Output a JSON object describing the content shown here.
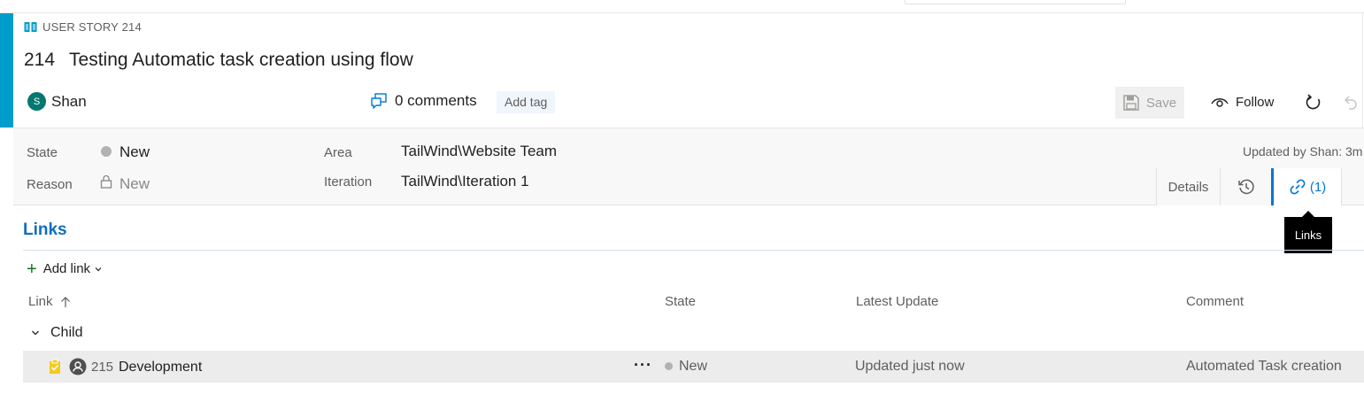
{
  "header": {
    "type_label": "USER STORY 214",
    "id": "214",
    "title": "Testing Automatic task creation using flow",
    "assignee_initial": "S",
    "assignee": "Shan",
    "comments": "0 comments",
    "add_tag": "Add tag",
    "save_label": "Save",
    "follow_label": "Follow"
  },
  "fields": {
    "state_label": "State",
    "state_value": "New",
    "reason_label": "Reason",
    "reason_value": "New",
    "area_label": "Area",
    "area_value": "TailWind\\Website Team",
    "iteration_label": "Iteration",
    "iteration_value": "TailWind\\Iteration 1",
    "updated_text": "Updated by Shan: 3m"
  },
  "tabs": {
    "details": "Details",
    "links": "(1)",
    "tooltip": "Links"
  },
  "links": {
    "section_title": "Links",
    "add_link": "Add link",
    "columns": {
      "link": "Link",
      "state": "State",
      "latest_update": "Latest Update",
      "comment": "Comment"
    },
    "group_label": "Child",
    "rows": [
      {
        "id": "215",
        "title": "Development",
        "state": "New",
        "latest_update": "Updated just now",
        "comment": "Automated Task creation"
      }
    ]
  },
  "colors": {
    "accent": "#009ccc",
    "link_blue": "#0078d4",
    "avatar": "#03786f",
    "state_new": "#b2b2b2"
  },
  "icons": {
    "type": "book-icon",
    "comments": "comment-icon",
    "save": "save-icon",
    "follow": "eye-icon",
    "refresh": "refresh-icon",
    "undo": "undo-icon",
    "history": "history-icon",
    "links": "link-icon",
    "sort": "arrow-up-icon",
    "task": "task-icon",
    "person": "person-badge-icon"
  }
}
